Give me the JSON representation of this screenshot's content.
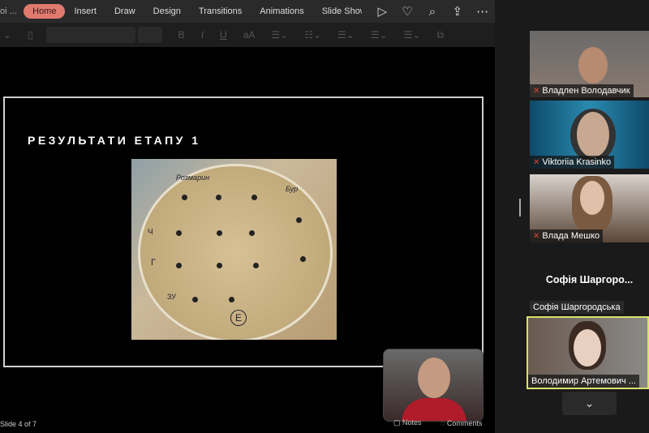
{
  "ribbon": {
    "doc_title": "oi ...",
    "tabs": [
      "Home",
      "Insert",
      "Draw",
      "Design",
      "Transitions",
      "Animations",
      "Slide Show"
    ],
    "active_tab": "Home"
  },
  "format_bar": {
    "bold": "B",
    "italic": "I",
    "underline": "U",
    "font_size_icon": "aA"
  },
  "slide": {
    "title": "РЕЗУЛЬТАТИ ЕТАПУ 1",
    "photo_labels": [
      "Розмарин",
      "Бур",
      "Ч",
      "Г",
      "ЗУ",
      "Е"
    ]
  },
  "status": {
    "slide_counter": "Slide 4 of 7",
    "notes": "Notes",
    "comments": "Comments"
  },
  "participants": [
    {
      "name": "Владлен Володавчик",
      "muted": true
    },
    {
      "name": "Viktoriia Krasinko",
      "muted": true
    },
    {
      "name": "Влада Мешко",
      "muted": true
    },
    {
      "name": "Софія Шаргородська",
      "display": "Софія  Шаргоро...",
      "muted": false
    },
    {
      "name": "Володимир Артемович ...",
      "muted": false,
      "active_speaker": true
    }
  ],
  "colors": {
    "accent_tab": "#e07a6f",
    "speaker_border": "#d8e36a",
    "muted_icon": "#e0443a"
  }
}
